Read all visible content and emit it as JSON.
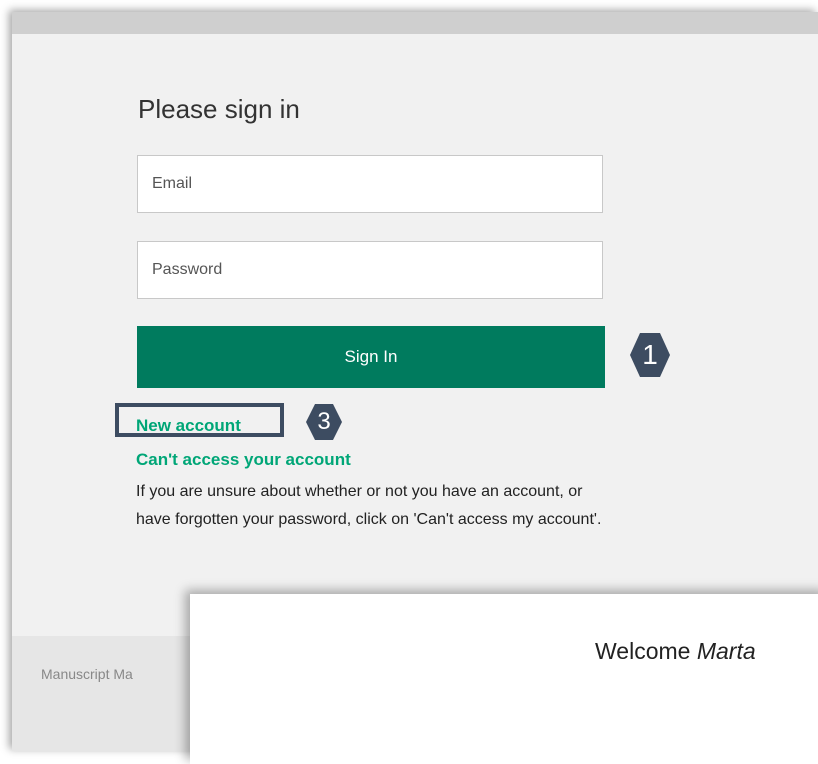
{
  "signin": {
    "title": "Please sign in",
    "email_placeholder": "Email",
    "password_placeholder": "Password",
    "button_label": "Sign In"
  },
  "links": {
    "new_account": "New account",
    "cant_access": "Can't access your account"
  },
  "help_text": "If you are unsure about whether or not you have an account, or have forgotten your password, click on 'Can't access my account'.",
  "badges": {
    "one": "1",
    "three": "3"
  },
  "footer": {
    "text": "Manuscript Ma"
  },
  "overlay": {
    "welcome_prefix": "Welcome",
    "welcome_name": "Marta"
  },
  "colors": {
    "button": "#007b5e",
    "link": "#00a677",
    "badge": "#3d4c61"
  }
}
